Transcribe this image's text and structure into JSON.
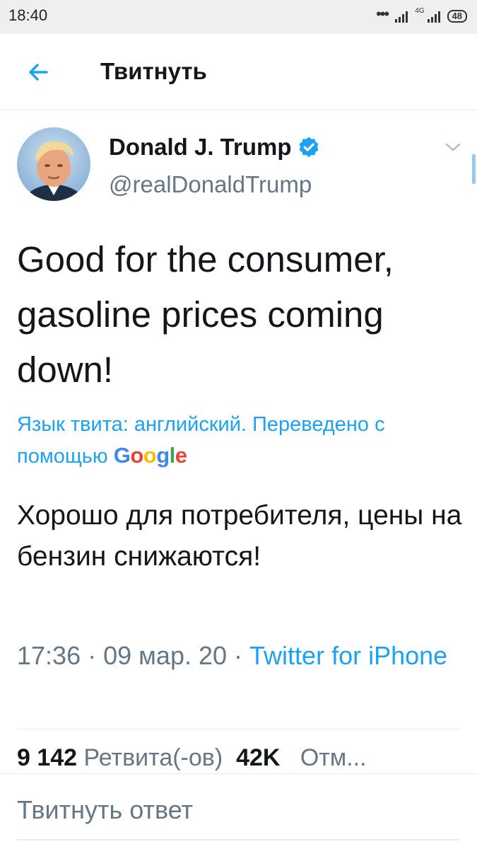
{
  "status_bar": {
    "time": "18:40",
    "network": "4G",
    "battery": "48"
  },
  "header": {
    "back_icon": "arrow-left-icon",
    "title": "Твитнуть"
  },
  "tweet": {
    "display_name": "Donald J. Trump",
    "handle": "@realDonaldTrump",
    "verified_icon": "verified-badge-icon",
    "text": "Good for the consumer, gasoline prices coming down!",
    "translation_note": "Язык твита: английский. Переведено с помощью",
    "translation_provider": "Google",
    "translated_text": "Хорошо для потребителя, цены на бензин снижаются!",
    "time": "17:36",
    "date": "09 мар. 20",
    "source": "Twitter for iPhone",
    "retweets_count": "9 142",
    "retweets_label": "Ретвита(-ов)",
    "likes_count": "42K",
    "likes_label": "Отм..."
  },
  "reply": {
    "placeholder": "Твитнуть ответ"
  },
  "colors": {
    "accent": "#1da1f2",
    "secondary_text": "#657786",
    "primary_text": "#14171a",
    "divider": "#e6ecf0"
  }
}
